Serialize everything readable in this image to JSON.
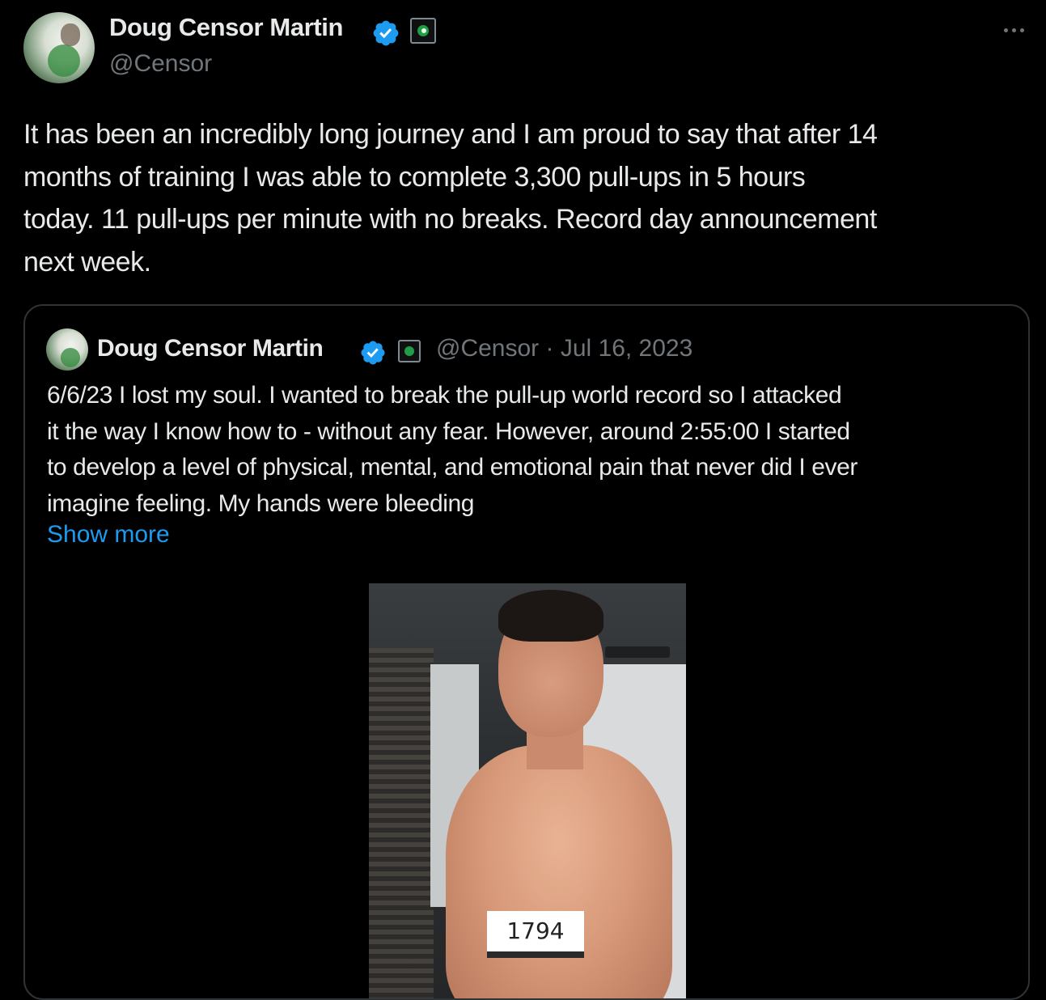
{
  "author": {
    "display_name": "Doug Censor Martin",
    "handle": "@Censor",
    "verified_icon": "verified-badge-icon",
    "affiliation_icon": "affiliate-badge-icon"
  },
  "post": {
    "text": "It has been an incredibly long journey and I am proud to say that after 14\nmonths of training I was able to complete 3,300 pull-ups in 5 hours\ntoday. 11 pull-ups per minute with no breaks. Record day announcement\nnext week."
  },
  "quoted": {
    "display_name": "Doug Censor Martin",
    "meta": "@Censor · Jul 16, 2023",
    "text": "6/6/23 I lost my soul. I wanted to break the pull-up world record so I attacked\nit the way I know how to - without any fear. However, around 2:55:00 I started\nto develop a level of physical, mental, and emotional pain that never did I ever\nimagine feeling. My hands were bleeding",
    "show_more": "Show more",
    "media_counter": "1794"
  },
  "colors": {
    "background": "#000000",
    "text_primary": "#e7e9ea",
    "text_secondary": "#71767b",
    "link": "#1d9bf0",
    "verified": "#1d9bf0",
    "border": "#2f3336"
  }
}
